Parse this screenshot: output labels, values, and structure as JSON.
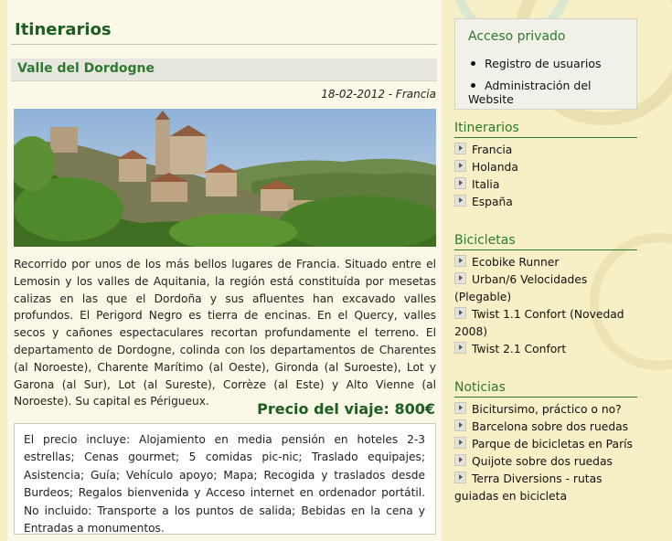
{
  "main": {
    "page_title": "Itinerarios",
    "article": {
      "title": "Valle del Dordogne",
      "meta": "18-02-2012 - Francia",
      "description": "Recorrido por unos de los más bellos lugares de Francia. Situado entre el Lemosin y los valles de Aquitania, la región está constituída por mesetas calizas en las que el Dordoña y sus afluentes han excavado valles profundos. El Perigord Negro es tierra de encinas. En el Quercy, valles secos y cañones espectaculares recortan profundamente el terreno. El departamento de Dordogne, colinda con los departamentos de Charentes (al Noroeste), Charente Marítimo (al Oeste), Gironda (al Suroeste), Lot y Garona (al Sur), Lot (al Sureste), Corrèze (al Este) y Alto Vienne (al Noroeste). Su capital es Périgueux.",
      "price": "Precio del viaje: 800€",
      "includes": "El precio incluye: Alojamiento en media pensión en hoteles 2-3 estrellas; Cenas gourmet; 5 comidas pic-nic; Traslado equipajes; Asistencia; Guía; Vehículo apoyo; Mapa; Recogida y traslados desde Burdeos; Regalos bienvenida y Acceso internet en ordenador portátil. No incluido: Transporte a los puntos de salida; Bebidas en la cena y Entradas a monumentos."
    }
  },
  "sidebar": {
    "login": {
      "title": "Acceso privado",
      "items": [
        "Registro de usuarios",
        "Administración del Website"
      ]
    },
    "itinerarios": {
      "heading": "Itinerarios",
      "items": [
        "Francia",
        "Holanda",
        "Italia",
        "España"
      ]
    },
    "bicicletas": {
      "heading": "Bicicletas",
      "items": [
        "Ecobike Runner",
        "Urban/6 Velocidades (Plegable)",
        "Twist 1.1 Confort (Novedad 2008)",
        "Twist 2.1 Confort"
      ]
    },
    "noticias": {
      "heading": "Noticias",
      "items": [
        "Bicitursimo, práctico o no?",
        "Barcelona sobre dos ruedas",
        "Parque de bicicletas en París",
        "Quijote sobre dos ruedas",
        "Terra Diversions - rutas guiadas en bicicleta"
      ]
    }
  },
  "colors": {
    "accent_green": "#2d7a2f",
    "title_green": "#1c5e21",
    "background": "#f7efc6"
  }
}
